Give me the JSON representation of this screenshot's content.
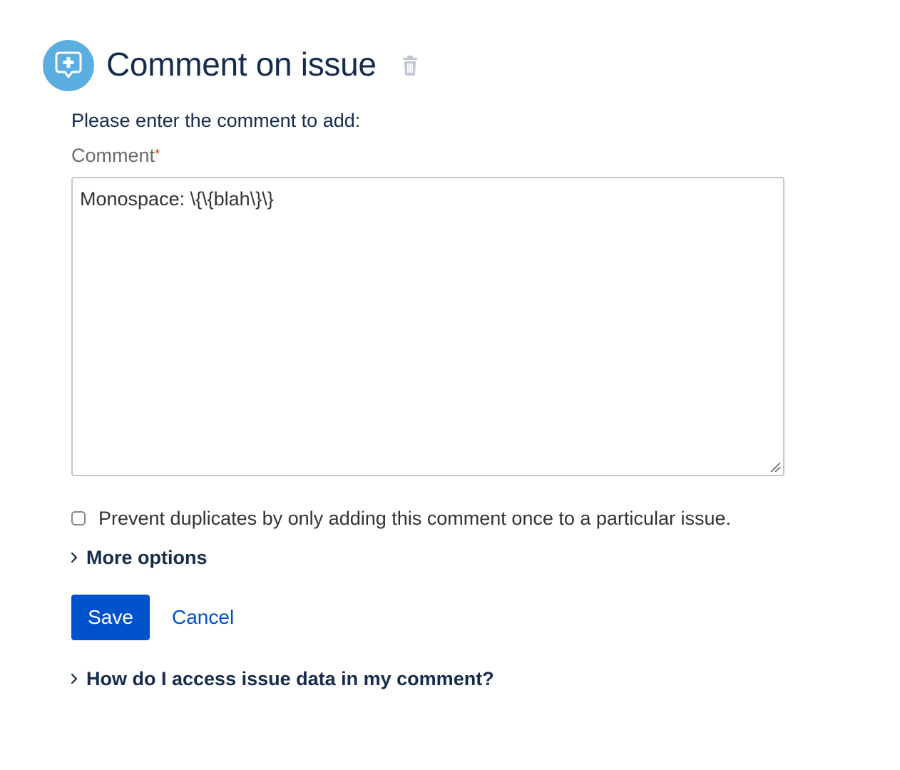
{
  "header": {
    "title": "Comment on issue",
    "icon": "comment-add-icon",
    "accent_color": "#5aaee0"
  },
  "form": {
    "instruction": "Please enter the comment to add:",
    "comment_label": "Comment",
    "required_marker": "*",
    "comment_value": "Monospace: \\{\\{blah\\}\\}",
    "prevent_duplicates_label": "Prevent duplicates by only adding this comment once to a particular issue.",
    "prevent_duplicates_checked": false
  },
  "more_options": {
    "label": "More options"
  },
  "actions": {
    "save_label": "Save",
    "cancel_label": "Cancel",
    "primary_color": "#0052cc"
  },
  "help": {
    "label": "How do I access issue data in my comment?"
  }
}
